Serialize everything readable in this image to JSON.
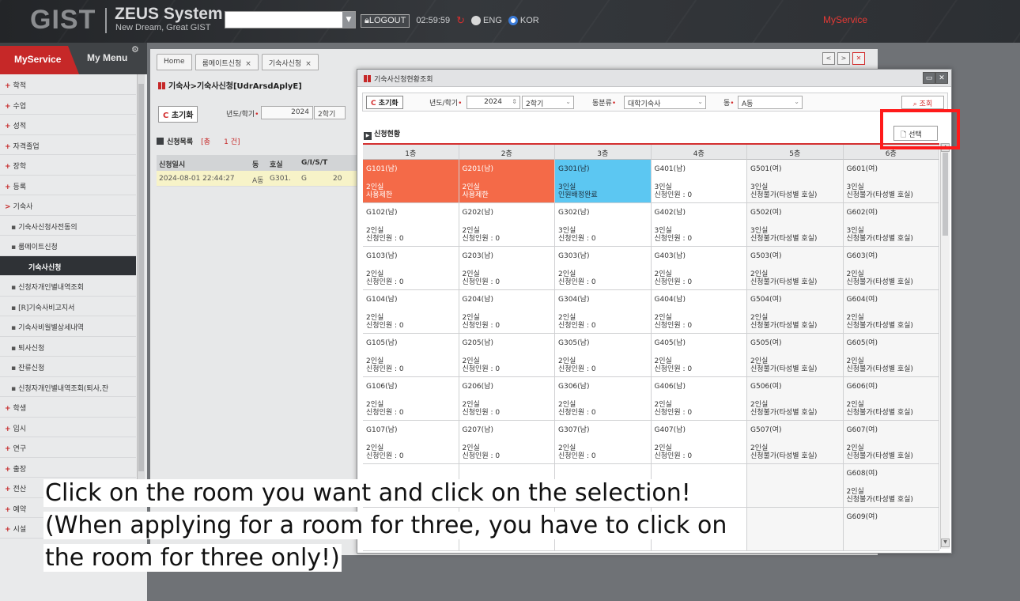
{
  "topbar": {
    "logo": "GIST",
    "system_title": "ZEUS System",
    "system_subtitle": "New Dream, Great GIST",
    "select_value": "",
    "logout_label": "LOGOUT",
    "timer": "02:59:59",
    "lang_eng": "ENG",
    "lang_kor": "KOR",
    "myservice_label": "MyService"
  },
  "sidebar": {
    "tab_myservice": "MyService",
    "tab_mymenu": "My Menu",
    "items": [
      {
        "label": "학적",
        "marker": "+"
      },
      {
        "label": "수업",
        "marker": "+"
      },
      {
        "label": "성적",
        "marker": "+"
      },
      {
        "label": "자격졸업",
        "marker": "+"
      },
      {
        "label": "장학",
        "marker": "+"
      },
      {
        "label": "등록",
        "marker": "+"
      },
      {
        "label": "기숙사",
        "marker": ">"
      },
      {
        "label": "기숙사신청사전동의",
        "marker": "▪"
      },
      {
        "label": "룸메이트신청",
        "marker": "▪"
      },
      {
        "label": "기숙사신청",
        "marker": ""
      },
      {
        "label": "신청자개인별내역조회",
        "marker": "▪"
      },
      {
        "label": "[R]기숙사비고지서",
        "marker": "▪"
      },
      {
        "label": "기숙사비월별상세내역",
        "marker": "▪"
      },
      {
        "label": "퇴사신청",
        "marker": "▪"
      },
      {
        "label": "잔류신청",
        "marker": "▪"
      },
      {
        "label": "신청자개인별내역조회(퇴사,잔",
        "marker": "▪"
      },
      {
        "label": "학생",
        "marker": "+"
      },
      {
        "label": "입시",
        "marker": "+"
      },
      {
        "label": "연구",
        "marker": "+"
      },
      {
        "label": "출장",
        "marker": "+"
      },
      {
        "label": "전산",
        "marker": "+"
      },
      {
        "label": "예약",
        "marker": "+"
      },
      {
        "label": "시설",
        "marker": "+"
      }
    ]
  },
  "main": {
    "tabs": [
      "Home",
      "룸메이트신청",
      "기숙사신청"
    ],
    "tab_close": "×",
    "page_title": "기숙사>기숙사신청[UdrArsdAplyE]",
    "reset_label": "초기화",
    "year_semester_label": "년도/학기",
    "year_value": "2024",
    "semester_value": "2학기",
    "list_title": "신청목록",
    "list_count_open": "[총",
    "list_count": "1 건]",
    "table_headers": [
      "신청일시",
      "동",
      "호실",
      "G/I/S/T",
      ""
    ],
    "table_rows": [
      [
        "2024-08-01 22:44:27",
        "A동",
        "G301.",
        "G",
        "20"
      ]
    ]
  },
  "popup": {
    "title": "기숙사신청현황조회",
    "reset_label": "초기화",
    "year_semester_label": "년도/학기",
    "year_value": "2024",
    "semester_value": "2학기",
    "building_type_label": "동분류",
    "building_type_value": "대학기숙사",
    "building_label": "동",
    "building_value": "A동",
    "search_label": "조회",
    "status_title": "신청현황",
    "select_label": "선택",
    "floors": [
      "1층",
      "2층",
      "3층",
      "4층",
      "5층",
      "6층"
    ],
    "rows": [
      [
        {
          "name": "G101(남)",
          "l1": "2인실",
          "l2": "사용제한",
          "s": "r"
        },
        {
          "name": "G201(남)",
          "l1": "2인실",
          "l2": "사용제한",
          "s": "r"
        },
        {
          "name": "G301(남)",
          "l1": "3인실",
          "l2": "인원배정완료",
          "s": "b"
        },
        {
          "name": "G401(남)",
          "l1": "3인실",
          "l2": "신청인원 : 0",
          "s": "w"
        },
        {
          "name": "G501(여)",
          "l1": "3인실",
          "l2": "신청불가(타성별 호실)",
          "s": "f"
        },
        {
          "name": "G601(여)",
          "l1": "3인실",
          "l2": "신청불가(타성별 호실)",
          "s": "f"
        }
      ],
      [
        {
          "name": "G102(남)",
          "l1": "2인실",
          "l2": "신청인원 : 0",
          "s": "w"
        },
        {
          "name": "G202(남)",
          "l1": "2인실",
          "l2": "신청인원 : 0",
          "s": "w"
        },
        {
          "name": "G302(남)",
          "l1": "3인실",
          "l2": "신청인원 : 0",
          "s": "w"
        },
        {
          "name": "G402(남)",
          "l1": "3인실",
          "l2": "신청인원 : 0",
          "s": "w"
        },
        {
          "name": "G502(여)",
          "l1": "3인실",
          "l2": "신청불가(타성별 호실)",
          "s": "f"
        },
        {
          "name": "G602(여)",
          "l1": "3인실",
          "l2": "신청불가(타성별 호실)",
          "s": "f"
        }
      ],
      [
        {
          "name": "G103(남)",
          "l1": "2인실",
          "l2": "신청인원 : 0",
          "s": "w"
        },
        {
          "name": "G203(남)",
          "l1": "2인실",
          "l2": "신청인원 : 0",
          "s": "w"
        },
        {
          "name": "G303(남)",
          "l1": "2인실",
          "l2": "신청인원 : 0",
          "s": "w"
        },
        {
          "name": "G403(남)",
          "l1": "2인실",
          "l2": "신청인원 : 0",
          "s": "w"
        },
        {
          "name": "G503(여)",
          "l1": "2인실",
          "l2": "신청불가(타성별 호실)",
          "s": "f"
        },
        {
          "name": "G603(여)",
          "l1": "2인실",
          "l2": "신청불가(타성별 호실)",
          "s": "f"
        }
      ],
      [
        {
          "name": "G104(남)",
          "l1": "2인실",
          "l2": "신청인원 : 0",
          "s": "w"
        },
        {
          "name": "G204(남)",
          "l1": "2인실",
          "l2": "신청인원 : 0",
          "s": "w"
        },
        {
          "name": "G304(남)",
          "l1": "2인실",
          "l2": "신청인원 : 0",
          "s": "w"
        },
        {
          "name": "G404(남)",
          "l1": "2인실",
          "l2": "신청인원 : 0",
          "s": "w"
        },
        {
          "name": "G504(여)",
          "l1": "2인실",
          "l2": "신청불가(타성별 호실)",
          "s": "f"
        },
        {
          "name": "G604(여)",
          "l1": "2인실",
          "l2": "신청불가(타성별 호실)",
          "s": "f"
        }
      ],
      [
        {
          "name": "G105(남)",
          "l1": "2인실",
          "l2": "신청인원 : 0",
          "s": "w"
        },
        {
          "name": "G205(남)",
          "l1": "2인실",
          "l2": "신청인원 : 0",
          "s": "w"
        },
        {
          "name": "G305(남)",
          "l1": "2인실",
          "l2": "신청인원 : 0",
          "s": "w"
        },
        {
          "name": "G405(남)",
          "l1": "2인실",
          "l2": "신청인원 : 0",
          "s": "w"
        },
        {
          "name": "G505(여)",
          "l1": "2인실",
          "l2": "신청불가(타성별 호실)",
          "s": "f"
        },
        {
          "name": "G605(여)",
          "l1": "2인실",
          "l2": "신청불가(타성별 호실)",
          "s": "f"
        }
      ],
      [
        {
          "name": "G106(남)",
          "l1": "2인실",
          "l2": "신청인원 : 0",
          "s": "w"
        },
        {
          "name": "G206(남)",
          "l1": "2인실",
          "l2": "신청인원 : 0",
          "s": "w"
        },
        {
          "name": "G306(남)",
          "l1": "2인실",
          "l2": "신청인원 : 0",
          "s": "w"
        },
        {
          "name": "G406(남)",
          "l1": "2인실",
          "l2": "신청인원 : 0",
          "s": "w"
        },
        {
          "name": "G506(여)",
          "l1": "2인실",
          "l2": "신청불가(타성별 호실)",
          "s": "f"
        },
        {
          "name": "G606(여)",
          "l1": "2인실",
          "l2": "신청불가(타성별 호실)",
          "s": "f"
        }
      ],
      [
        {
          "name": "G107(남)",
          "l1": "2인실",
          "l2": "신청인원 : 0",
          "s": "w"
        },
        {
          "name": "G207(남)",
          "l1": "2인실",
          "l2": "신청인원 : 0",
          "s": "w"
        },
        {
          "name": "G307(남)",
          "l1": "2인실",
          "l2": "신청인원 : 0",
          "s": "w"
        },
        {
          "name": "G407(남)",
          "l1": "2인실",
          "l2": "신청인원 : 0",
          "s": "w"
        },
        {
          "name": "G507(여)",
          "l1": "2인실",
          "l2": "신청불가(타성별 호실)",
          "s": "f"
        },
        {
          "name": "G607(여)",
          "l1": "2인실",
          "l2": "신청불가(타성별 호실)",
          "s": "f"
        }
      ],
      [
        {
          "name": "",
          "l1": "",
          "l2": "",
          "s": "w"
        },
        {
          "name": "",
          "l1": "",
          "l2": "",
          "s": "w"
        },
        {
          "name": "",
          "l1": "",
          "l2": "",
          "s": "w"
        },
        {
          "name": "",
          "l1": "",
          "l2": "",
          "s": "w"
        },
        {
          "name": "",
          "l1": "",
          "l2": "",
          "s": "f"
        },
        {
          "name": "G608(여)",
          "l1": "2인실",
          "l2": "신청불가(타성별 호실)",
          "s": "f"
        }
      ],
      [
        {
          "name": "",
          "l1": "",
          "l2": "",
          "s": "w"
        },
        {
          "name": "",
          "l1": "",
          "l2": "",
          "s": "w"
        },
        {
          "name": "",
          "l1": "",
          "l2": "",
          "s": "w"
        },
        {
          "name": "",
          "l1": "",
          "l2": "",
          "s": "w"
        },
        {
          "name": "",
          "l1": "",
          "l2": "",
          "s": "f"
        },
        {
          "name": "G609(여)",
          "l1": "",
          "l2": "",
          "s": "f"
        }
      ]
    ]
  },
  "caption": {
    "line1": "Click on the room you want and click on the selection!",
    "line2": "(When applying for a room for three, you have to click on",
    "line3": "the room for three only!)"
  },
  "colors": {
    "brand_red": "#c62828",
    "restricted_cell": "#f46a48",
    "assigned_cell": "#5cc7f2",
    "highlight_box": "#ff1a1a"
  }
}
